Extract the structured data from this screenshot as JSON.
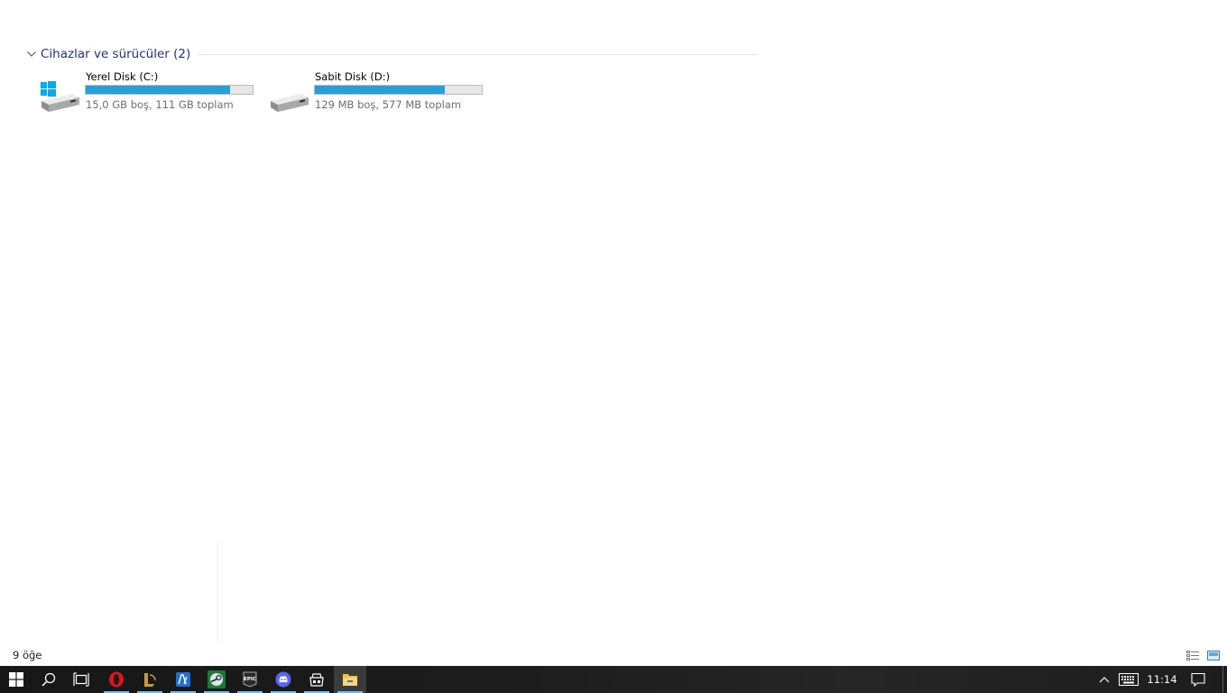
{
  "group": {
    "title": "Cihazlar ve sürücüler (2)"
  },
  "drives": [
    {
      "name": "Yerel Disk (C:)",
      "info": "15,0 GB boş, 111 GB toplam",
      "used_fraction": 0.865,
      "icon": "windows-drive-icon"
    },
    {
      "name": "Sabit Disk (D:)",
      "info": "129 MB boş, 577 MB toplam",
      "used_fraction": 0.776,
      "icon": "hard-drive-icon"
    }
  ],
  "status": {
    "item_count": "9 öğe"
  },
  "taskbar": {
    "apps": [
      "windows-start-icon",
      "search-icon",
      "task-view-icon",
      "opera-icon",
      "league-of-legends-icon",
      "app-icon-blue",
      "steam-icon",
      "epic-games-icon",
      "discord-icon",
      "store-icon",
      "file-explorer-icon"
    ],
    "clock": "11:14"
  },
  "colors": {
    "accent_bar": "#26a0da",
    "taskbar_bg": "#1c1c1c",
    "group_title": "#1e3287"
  }
}
